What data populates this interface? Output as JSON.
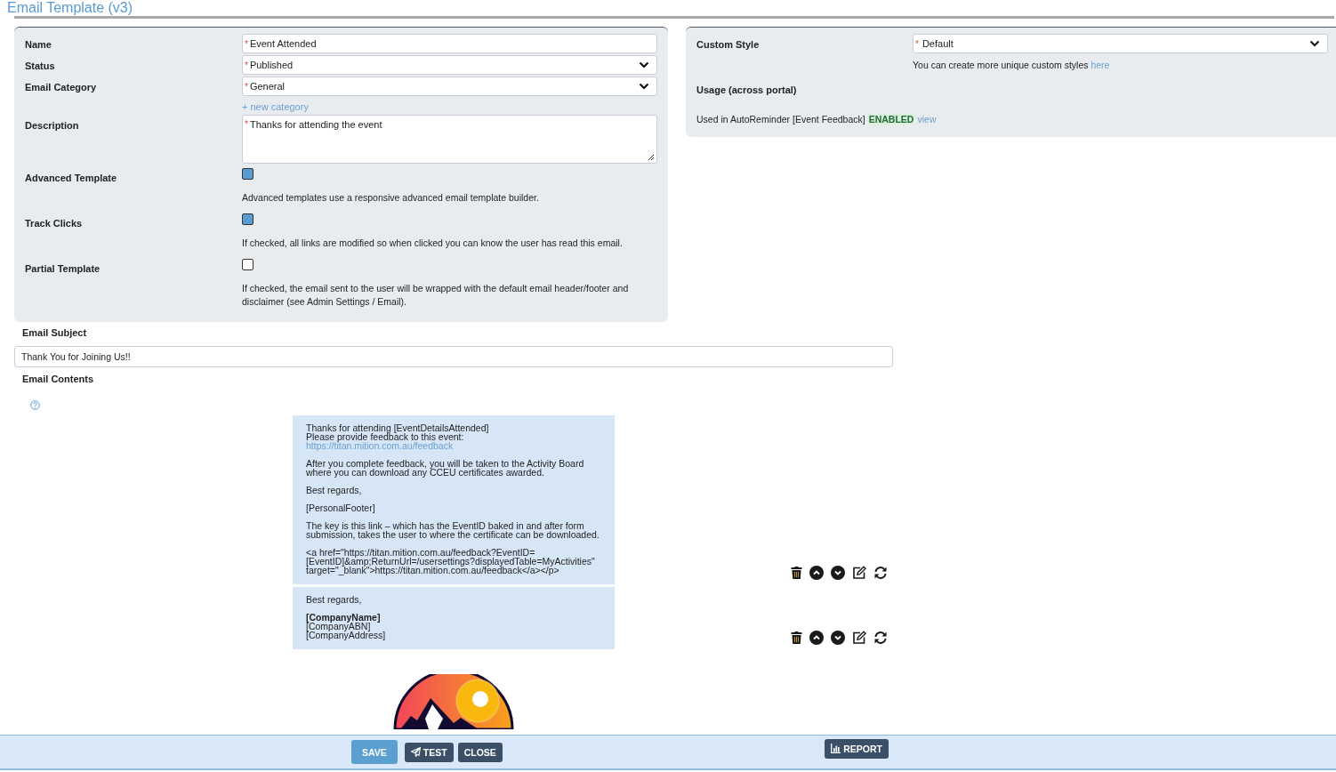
{
  "page": {
    "title": "Email Template (v3)"
  },
  "settings": {
    "fields": [
      {
        "kind": "text",
        "label": "Name",
        "required_mark": "*",
        "value": "Event Attended"
      },
      {
        "kind": "select",
        "label": "Status",
        "required_mark": "*",
        "value": "Published"
      },
      {
        "kind": "select",
        "label": "Email Category",
        "required_mark": "*",
        "value": "General",
        "link": "+ new category"
      },
      {
        "kind": "textarea",
        "label": "Description",
        "required_mark": "*",
        "value": "Thanks for attending the event"
      },
      {
        "kind": "checkbox",
        "label": "Advanced Template",
        "checked": true,
        "help": "Advanced templates use a responsive advanced email template builder."
      },
      {
        "kind": "checkbox",
        "label": "Track Clicks",
        "checked": true,
        "help": "If checked, all links are modified so when clicked you can know the user has read this email."
      },
      {
        "kind": "checkbox",
        "label": "Partial Template",
        "checked": false,
        "help": "If checked, the email sent to the user will be wrapped with the default email header/footer and disclaimer (see Admin Settings / Email)."
      }
    ]
  },
  "style_panel": {
    "custom_style": {
      "label": "Custom Style",
      "required_mark": "*",
      "value": "Default",
      "help": "You can create more unique custom styles",
      "help_link": "here"
    },
    "usage": {
      "heading": "Usage (across portal)",
      "text": "Used in AutoReminder [Event Feedback]",
      "status": "ENABLED",
      "link": "view"
    }
  },
  "subject": {
    "label": "Email Subject",
    "value": "Thank You for Joining Us!!"
  },
  "contents": {
    "label": "Email Contents",
    "blocks": [
      {
        "paragraphs": [
          [
            {
              "kind": "text",
              "text": "Thanks for attending [EventDetailsAttended]"
            },
            {
              "kind": "text",
              "text": "Please provide feedback to this event:"
            },
            {
              "kind": "link",
              "text": "https://titan.mition.com.au/feedback"
            }
          ],
          [
            {
              "kind": "text",
              "text": "After you complete feedback, you will be taken to the Activity Board where you can download any CCEU certificates awarded."
            }
          ],
          [
            {
              "kind": "text",
              "text": "Best regards,"
            }
          ],
          [
            {
              "kind": "text",
              "text": "[PersonalFooter]"
            }
          ],
          [
            {
              "kind": "text",
              "text": "The key is this link – which has the EventID baked in and after form submission, takes the user to where the certificate can be downloaded."
            }
          ],
          [
            {
              "kind": "text",
              "text": "<a href=\"https://titan.mition.com.au/feedback?EventID=[EventID]&amp;ReturnUrl=/usersettings?displayedTable=MyActivities\" target=\"_blank\">https://titan.mition.com.au/feedback</a></p>"
            }
          ]
        ]
      },
      {
        "paragraphs": [
          [
            {
              "kind": "text",
              "text": "Best regards,"
            }
          ],
          [
            {
              "kind": "bold",
              "text": "[CompanyName]"
            },
            {
              "kind": "text",
              "text": "[CompanyABN]"
            },
            {
              "kind": "text",
              "text": "[CompanyAddress]"
            }
          ]
        ]
      }
    ]
  },
  "actions": [
    {
      "kind": "save",
      "label": "SAVE"
    },
    {
      "kind": "test",
      "label": "TEST"
    },
    {
      "kind": "close",
      "label": "CLOSE"
    },
    {
      "kind": "report",
      "label": "REPORT"
    }
  ]
}
